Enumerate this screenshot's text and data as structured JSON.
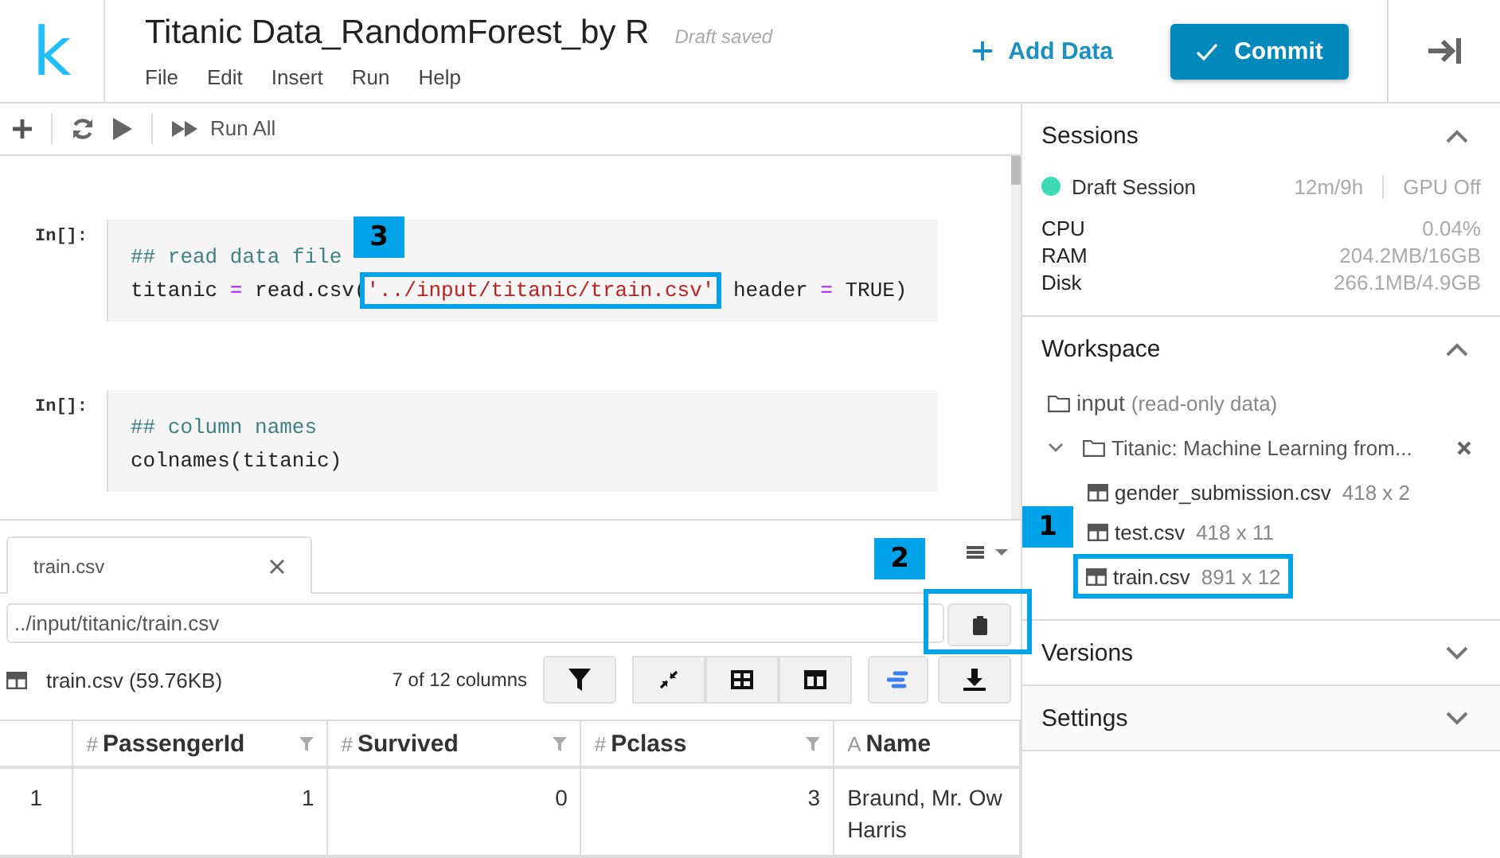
{
  "header": {
    "logo": "k",
    "title": "Titanic Data_RandomForest_by R",
    "save_status": "Draft saved",
    "menu": [
      "File",
      "Edit",
      "Insert",
      "Run",
      "Help"
    ],
    "add_data": "Add Data",
    "commit": "Commit"
  },
  "toolbar": {
    "run_all": "Run All"
  },
  "cells": [
    {
      "prompt": "In[]:",
      "lines": [
        [
          {
            "kind": "comment",
            "text": "## read data file"
          }
        ],
        [
          {
            "kind": "plain",
            "text": "titanic "
          },
          {
            "kind": "operator",
            "text": "="
          },
          {
            "kind": "plain",
            "text": " read.csv("
          },
          {
            "kind": "string",
            "text": "'../input/titanic/train.csv'",
            "highlighted": true,
            "marker": "3"
          },
          {
            "kind": "plain",
            "text": " header "
          },
          {
            "kind": "operator",
            "text": "="
          },
          {
            "kind": "plain",
            "text": " TRUE)"
          }
        ]
      ]
    },
    {
      "prompt": "In[]:",
      "lines": [
        [
          {
            "kind": "comment",
            "text": "## column names"
          }
        ],
        [
          {
            "kind": "plain",
            "text": "colnames(titanic)"
          }
        ]
      ]
    }
  ],
  "data_viewer": {
    "tabs": [
      {
        "label": "train.csv",
        "selected": true
      }
    ],
    "path": "../input/titanic/train.csv",
    "copy_highlighted": true,
    "copy_marker": "2",
    "file_label": "train.csv (59.76KB)",
    "columns_count": "7 of 12 columns",
    "columns": [
      {
        "kind": "index"
      },
      {
        "kind": "data",
        "type": "#",
        "name": "PassengerId",
        "filter": true
      },
      {
        "kind": "data",
        "type": "#",
        "name": "Survived",
        "filter": true
      },
      {
        "kind": "data",
        "type": "#",
        "name": "Pclass",
        "filter": true
      },
      {
        "kind": "data",
        "type": "A",
        "name": "Name"
      }
    ],
    "rows": [
      [
        [
          "1"
        ],
        [
          "1"
        ],
        [
          "0"
        ],
        [
          "3"
        ],
        [
          "Braund, Mr. Ow",
          "Harris"
        ]
      ]
    ]
  },
  "sidebar": {
    "sections": [
      {
        "kind": "sessions",
        "title": "Sessions",
        "expanded": true,
        "session": {
          "name": "Draft Session",
          "time": "12m/9h",
          "gpu": "GPU Off"
        },
        "stats": [
          {
            "label": "CPU",
            "value": "0.04%"
          },
          {
            "label": "RAM",
            "value": "204.2MB/16GB"
          },
          {
            "label": "Disk",
            "value": "266.1MB/4.9GB"
          }
        ]
      },
      {
        "kind": "workspace",
        "title": "Workspace",
        "expanded": true,
        "tree": [
          {
            "kind": "folder",
            "name": "input",
            "note": "(read-only data)",
            "children": [
              {
                "kind": "dataset",
                "name": "Titanic: Machine Learning from...",
                "expanded": true,
                "children": [
                  {
                    "kind": "file",
                    "name": "gender_submission.csv",
                    "size": "418 x 2",
                    "highlighted": false
                  },
                  {
                    "kind": "file",
                    "name": "test.csv",
                    "size": "418 x 11",
                    "highlighted": false
                  },
                  {
                    "kind": "file",
                    "name": "train.csv",
                    "size": "891 x 12",
                    "highlighted": true,
                    "marker": "1"
                  }
                ]
              }
            ]
          }
        ]
      },
      {
        "title": "Versions",
        "expanded": false
      },
      {
        "title": "Settings",
        "expanded": false
      }
    ]
  }
}
